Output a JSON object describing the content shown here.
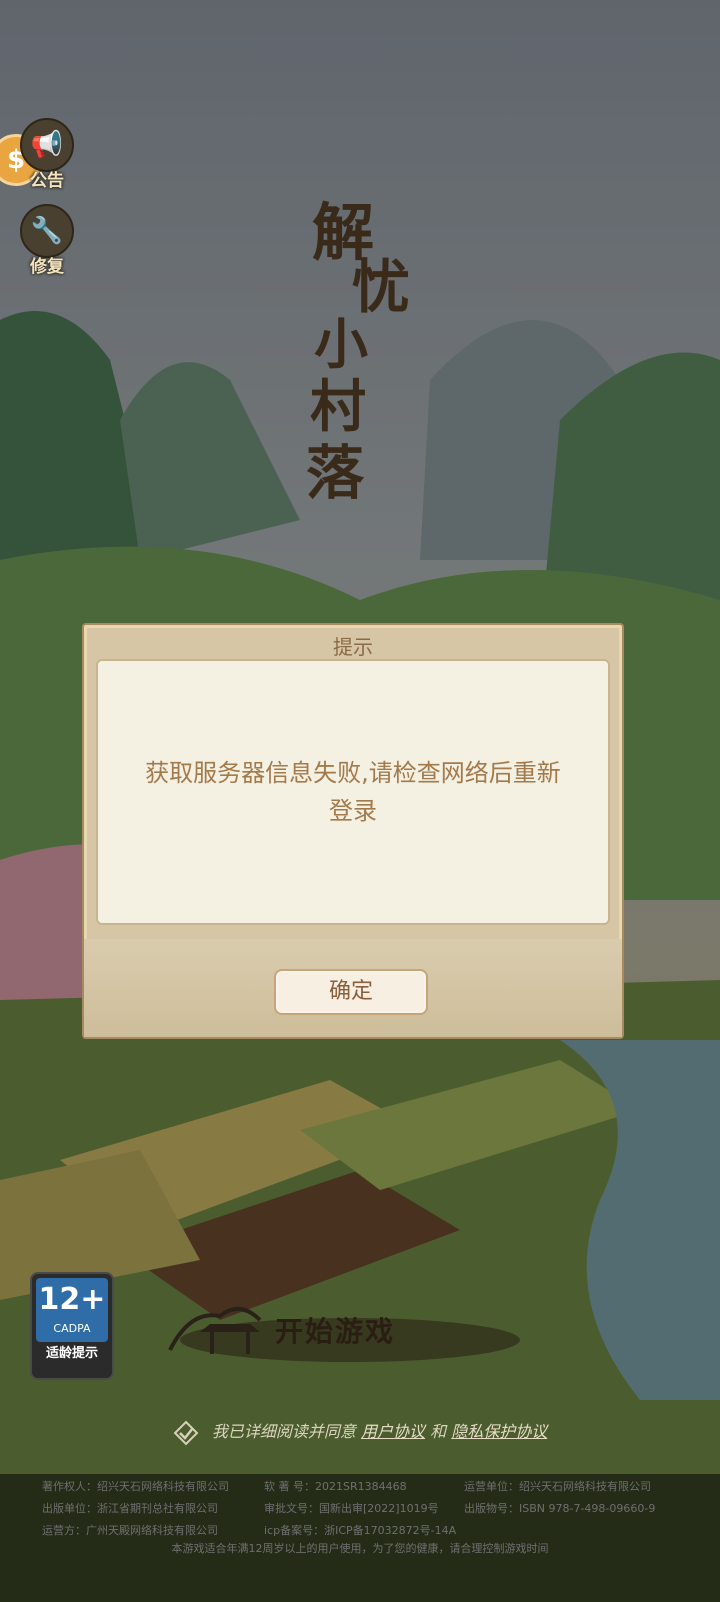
{
  "side_buttons": {
    "notice_label": "公告",
    "repair_label": "修复",
    "coin_glyph": "$"
  },
  "title": {
    "chars": [
      "解",
      "忧",
      "小",
      "村",
      "落"
    ]
  },
  "dialog": {
    "title": "提示",
    "message": "获取服务器信息失败,请检查网络后重新登录",
    "ok_label": "确定"
  },
  "age_rating": {
    "number": "12+",
    "org": "CADPA",
    "tip": "适龄提示"
  },
  "start_button": {
    "label": "开始游戏"
  },
  "agreement": {
    "prefix": "我已详细阅读并同意",
    "user_link": "用户协议",
    "and": "和",
    "privacy_link": "隐私保护协议"
  },
  "footer": {
    "rows": [
      [
        "著作权人：绍兴天石网络科技有限公司",
        "软 著 号：2021SR1384468",
        "运营单位：绍兴天石网络科技有限公司"
      ],
      [
        "出版单位：浙江省期刊总社有限公司",
        "审批文号：国新出审[2022]1019号",
        "出版物号：ISBN 978-7-498-09660-9"
      ],
      [
        "运营方：广州天殿网络科技有限公司",
        "icp备案号：浙ICP备17032872号-14A",
        ""
      ]
    ],
    "note": "本游戏适合年满12周岁以上的用户使用，为了您的健康，请合理控制游戏时间"
  },
  "colors": {
    "dialog_bg": "#d6c6a6",
    "dialog_text": "#a27a4c",
    "accent": "#2e6da8"
  }
}
